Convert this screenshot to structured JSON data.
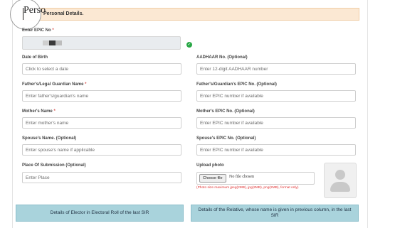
{
  "section": {
    "title": "Personal Details."
  },
  "magnifier": {
    "text": "Perso"
  },
  "epic": {
    "label": "Enter EPIC No",
    "required": "*"
  },
  "fields": {
    "dob": {
      "label": "Date of Birth",
      "placeholder": "Click to select a date"
    },
    "aadhaar": {
      "label": "AADHAAR No. (Optional)",
      "placeholder": "Enter 12-digit AADHAAR number"
    },
    "guardian_name": {
      "label": "Father's/Legal Guardian Name",
      "required": "*",
      "placeholder": "Enter father's/guardian's name"
    },
    "guardian_epic": {
      "label": "Father's/Guardian's EPIC No. (Optional)",
      "placeholder": "Enter EPIC number if available"
    },
    "mother_name": {
      "label": "Mother's Name",
      "required": "*",
      "placeholder": "Enter mother's name"
    },
    "mother_epic": {
      "label": "Mother's EPIC No. (Optional)",
      "placeholder": "Enter EPIC number if available"
    },
    "spouse_name": {
      "label": "Spouse's Name. (Optional)",
      "placeholder": "Enter spouse's name if applicable"
    },
    "spouse_epic": {
      "label": "Spouse's EPIC No. (Optional)",
      "placeholder": "Enter EPIC number if available"
    },
    "place": {
      "label": "Place Of Submission (Optional)",
      "placeholder": "Enter Place"
    }
  },
  "upload": {
    "label": "Upload photo",
    "button": "Choose file",
    "status": "No file chosen",
    "hint": "(Photo size maximum jpeg(2MB), jpg(2MB), png(2MB), format only)"
  },
  "buttons": {
    "elector": "Details of Elector in Electoral Roll of the last SIR",
    "relative": "Details of the Relative, whose name is given in previous column, in the last SIR"
  },
  "colors": {
    "accent": "#a9d3dc",
    "header_bg": "#fbe8d3",
    "required": "#d9534f",
    "hint": "#e03131",
    "verified": "#28a745"
  },
  "icons": {
    "verified": "check-circle-icon",
    "photo": "user-avatar-icon"
  }
}
